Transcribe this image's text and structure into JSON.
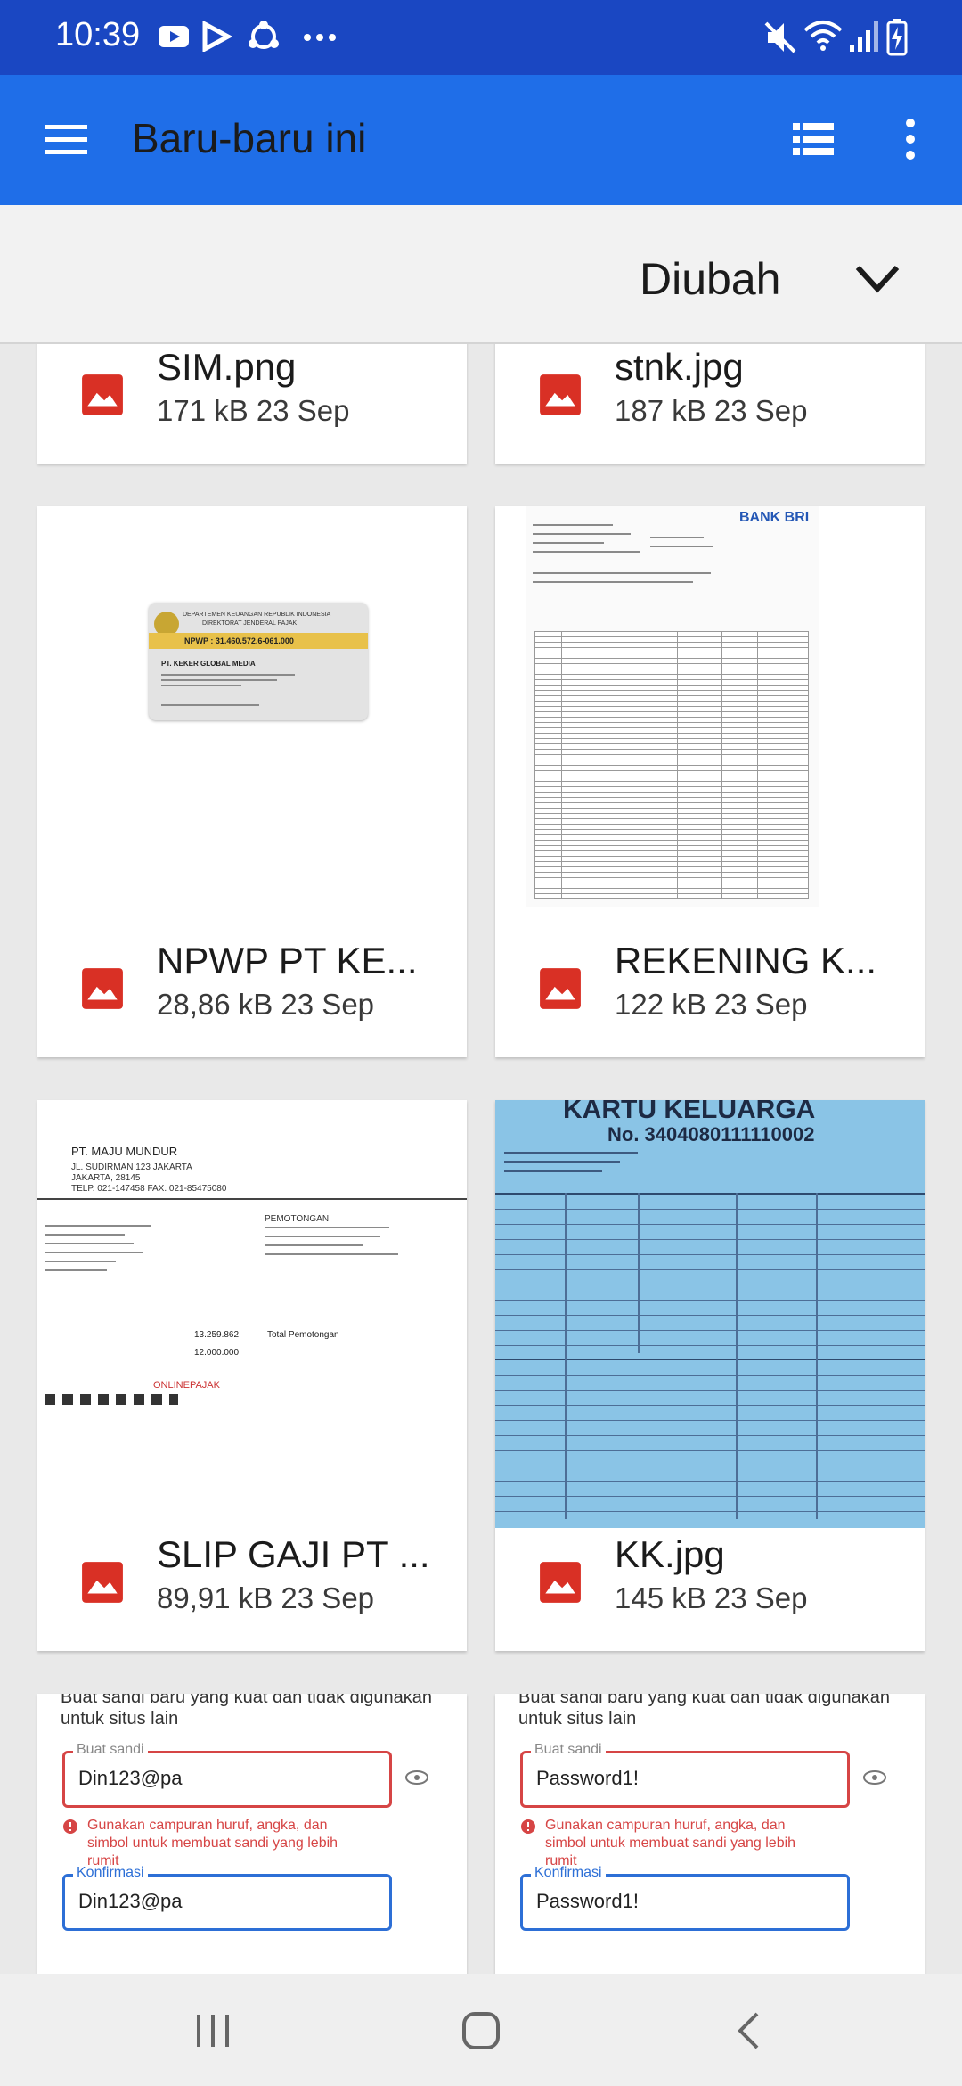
{
  "status_bar": {
    "time": "10:39"
  },
  "app_bar": {
    "title": "Baru-baru ini"
  },
  "sort": {
    "label": "Diubah"
  },
  "files": [
    {
      "name": "SIM.png",
      "info": "171 kB 23 Sep"
    },
    {
      "name": "stnk.jpg",
      "info": "187 kB 23 Sep"
    },
    {
      "name": "NPWP PT KE...",
      "info": "28,86 kB 23 Sep"
    },
    {
      "name": "REKENING K...",
      "info": "122 kB 23 Sep"
    },
    {
      "name": "SLIP GAJI PT ...",
      "info": "89,91 kB 23 Sep"
    },
    {
      "name": "KK.jpg",
      "info": "145 kB 23 Sep"
    }
  ],
  "thumbs": {
    "npwp": {
      "header1": "DEPARTEMEN KEUANGAN REPUBLIK INDONESIA",
      "header2": "DIREKTORAT JENDERAL PAJAK",
      "number": "NPWP : 31.460.572.6-061.000",
      "company": "PT. KEKER GLOBAL MEDIA"
    },
    "bank": {
      "brand": "BANK BRI"
    },
    "slip": {
      "company": "PT. MAJU MUNDUR",
      "address": "JL. SUDIRMAN 123 JAKARTA",
      "city": "JAKARTA, 28145",
      "phone": "TELP. 021-147458  FAX. 021-85475080",
      "deduction": "PEMOTONGAN",
      "total_label": "Total Pemotongan",
      "gross": "13.259.862",
      "net": "12.000.000",
      "footer": "ONLINEPAJAK"
    },
    "kk": {
      "title": "KARTU KELUARGA",
      "number": "No. 3404080111110002"
    },
    "password_left": {
      "hint": "Buat sandi baru yang kuat dan tidak digunakan untuk situs lain",
      "field_label": "Buat sandi",
      "value": "Din123@pa",
      "error": "Gunakan campuran huruf, angka, dan simbol untuk membuat sandi yang lebih rumit",
      "confirm_label": "Konfirmasi",
      "confirm_value": "Din123@pa"
    },
    "password_right": {
      "hint": "Buat sandi baru yang kuat dan tidak digunakan untuk situs lain",
      "field_label": "Buat sandi",
      "value": "Password1!",
      "error": "Gunakan campuran huruf, angka, dan simbol untuk membuat sandi yang lebih rumit",
      "confirm_label": "Konfirmasi",
      "confirm_value": "Password1!"
    }
  },
  "colors": {
    "status_bar": "#1a47c2",
    "app_bar": "#1f6ee8",
    "image_icon": "#d93025"
  }
}
